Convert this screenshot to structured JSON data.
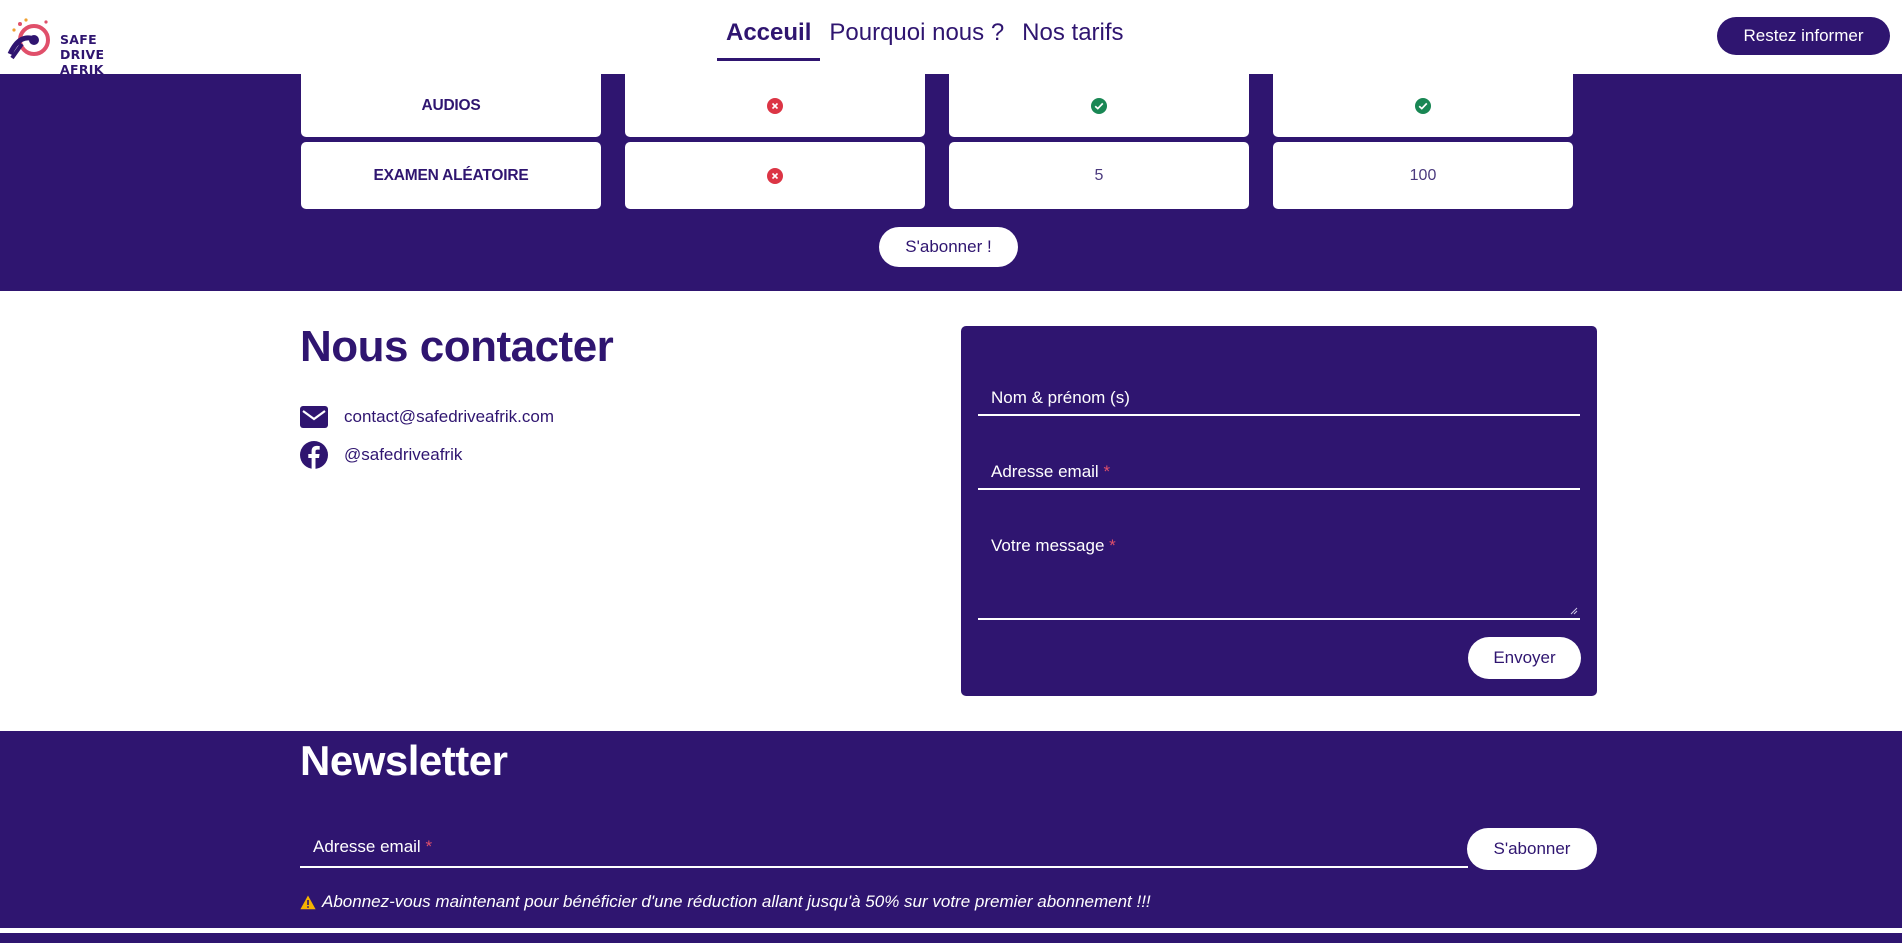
{
  "brand": {
    "name_lines": [
      "SAFE",
      "DRIVE",
      "AFRIK"
    ],
    "color": "#2f1570",
    "accent": "#e04f6a"
  },
  "nav": {
    "items": [
      {
        "label": "Acceuil",
        "active": true
      },
      {
        "label": "Pourquoi nous ?",
        "active": false
      },
      {
        "label": "Nos tarifs",
        "active": false
      }
    ],
    "cta_label": "Restez informer"
  },
  "pricing": {
    "rows": [
      {
        "feature": "AUDIOS",
        "values": [
          "no",
          "yes",
          "yes"
        ]
      },
      {
        "feature": "EXAMEN ALÉATOIRE",
        "values": [
          "no",
          "5",
          "100"
        ]
      }
    ],
    "subscribe_label": "S'abonner !"
  },
  "contact": {
    "title": "Nous contacter",
    "email": "contact@safedriveafrik.com",
    "facebook": "@safedriveafrik",
    "form": {
      "name_placeholder": "Nom & prénom (s)",
      "email_placeholder": "Adresse email",
      "message_placeholder": "Votre message",
      "required_mark": "*",
      "send_label": "Envoyer"
    }
  },
  "newsletter": {
    "title": "Newsletter",
    "email_placeholder": "Adresse email",
    "required_mark": "*",
    "button_label": "S'abonner",
    "note": "Abonnez-vous maintenant pour bénéficier d'une réduction allant jusqu'à 50% sur votre premier abonnement !!!"
  }
}
